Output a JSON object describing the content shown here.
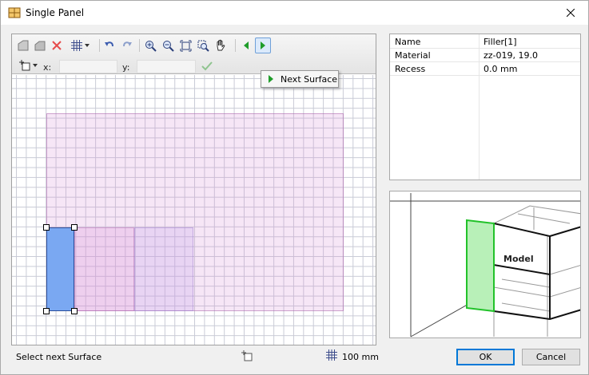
{
  "window": {
    "title": "Single Panel",
    "close_icon": "close-icon"
  },
  "toolbar": {
    "icons": [
      "panel-add-icon",
      "panel-remove-icon",
      "delete-icon",
      "grid-icon",
      "undo-icon",
      "redo-icon",
      "zoom-in-icon",
      "zoom-out-icon",
      "zoom-fit-icon",
      "zoom-window-icon",
      "pan-hand-icon",
      "previous-surface-icon",
      "next-surface-icon"
    ],
    "x_label": "x:",
    "y_label": "y:",
    "x_value": "",
    "y_value": "",
    "confirm_icon": "checkmark-icon",
    "tooltip": "Next Surface"
  },
  "properties": {
    "rows": [
      {
        "name": "Name",
        "value": "Filler[1]"
      },
      {
        "name": "Material",
        "value": "zz-019, 19.0"
      },
      {
        "name": "Recess",
        "value": "0.0 mm"
      }
    ]
  },
  "preview": {
    "model_label": "Model"
  },
  "status": {
    "message": "Select next Surface",
    "grid_size": "100 mm"
  },
  "buttons": {
    "ok": "OK",
    "cancel": "Cancel"
  },
  "colors": {
    "selected_panel": "#7aa8f2",
    "panel_fill": "#e6c8e6",
    "preview_highlight": "#22c22a",
    "accent": "#0078d7"
  }
}
